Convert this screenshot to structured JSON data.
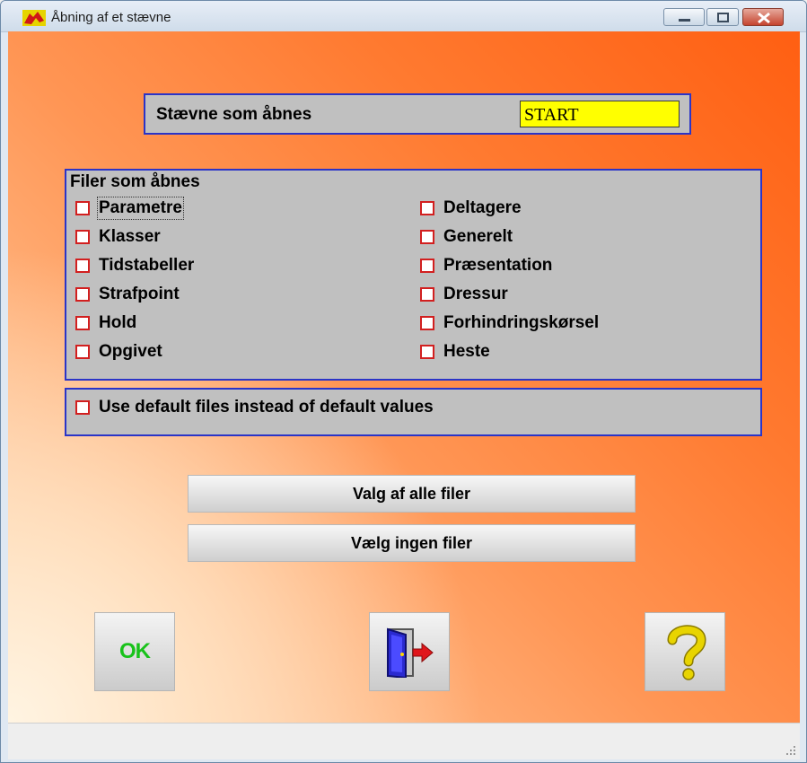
{
  "window": {
    "title": "Åbning af et stævne"
  },
  "event": {
    "label": "Stævne som åbnes",
    "value": "START"
  },
  "files": {
    "header": "Filer som åbnes",
    "left": [
      {
        "label": "Parametre",
        "checked": false
      },
      {
        "label": "Klasser",
        "checked": false
      },
      {
        "label": "Tidstabeller",
        "checked": false
      },
      {
        "label": "Strafpoint",
        "checked": false
      },
      {
        "label": "Hold",
        "checked": false
      },
      {
        "label": "Opgivet",
        "checked": false
      }
    ],
    "right": [
      {
        "label": "Deltagere",
        "checked": false
      },
      {
        "label": "Generelt",
        "checked": false
      },
      {
        "label": "Præsentation",
        "checked": false
      },
      {
        "label": "Dressur",
        "checked": false
      },
      {
        "label": "Forhindringskørsel",
        "checked": false
      },
      {
        "label": "Heste",
        "checked": false
      }
    ]
  },
  "default_files": {
    "label": "Use default files instead of default values",
    "checked": false
  },
  "buttons": {
    "select_all": "Valg af alle filer",
    "select_none": "Vælg ingen filer",
    "ok": "OK",
    "exit_icon": "exit-door-icon",
    "help_icon": "question-mark-icon"
  },
  "colors": {
    "panel_border": "#2b34c7",
    "checkbox_border": "#d21f1f",
    "event_field_bg": "#ffff00",
    "ok_text": "#18c21a",
    "help_icon": "#e8d400"
  }
}
